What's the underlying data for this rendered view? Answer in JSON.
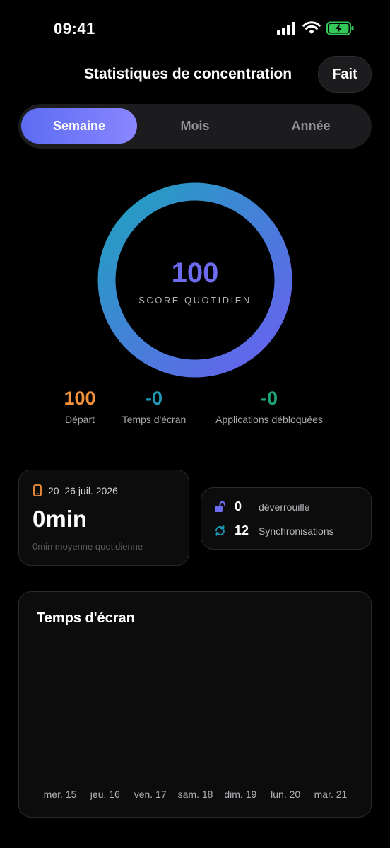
{
  "status_bar": {
    "time": "09:41"
  },
  "header": {
    "title": "Statistiques de concentration",
    "done_label": "Fait"
  },
  "segments": [
    {
      "label": "Semaine",
      "active": true
    },
    {
      "label": "Mois",
      "active": false
    },
    {
      "label": "Année",
      "active": false
    }
  ],
  "score": {
    "value": "100",
    "label": "SCORE QUOTIDIEN",
    "progress": 1.0
  },
  "stats": [
    {
      "value": "100",
      "label": "Départ",
      "color": "#f5913a"
    },
    {
      "value": "-0",
      "label": "Temps d'écran",
      "color": "#1f9ab8"
    },
    {
      "value": "-0",
      "label": "Applications débloquées",
      "color": "#1fa37a"
    }
  ],
  "week_card": {
    "date_range": "20–26 juil. 2026",
    "total": "0min",
    "average": "0min moyenne quotidienne"
  },
  "counts_card": {
    "unlocks": {
      "value": "0",
      "label": "déverrouille"
    },
    "syncs": {
      "value": "12",
      "label": "Synchronisations"
    }
  },
  "chart": {
    "title": "Temps d'écran",
    "chart_data": {
      "type": "bar",
      "title": "Temps d'écran",
      "categories": [
        "mer. 15",
        "jeu. 16",
        "ven. 17",
        "sam. 18",
        "dim. 19",
        "lun. 20",
        "mar. 21"
      ],
      "values": [
        0,
        0,
        0,
        0,
        0,
        0,
        0
      ]
    }
  },
  "colors": {
    "accent": "#5c6cf2",
    "ring_start": "#6366f1",
    "ring_end": "#1fa0c0"
  }
}
